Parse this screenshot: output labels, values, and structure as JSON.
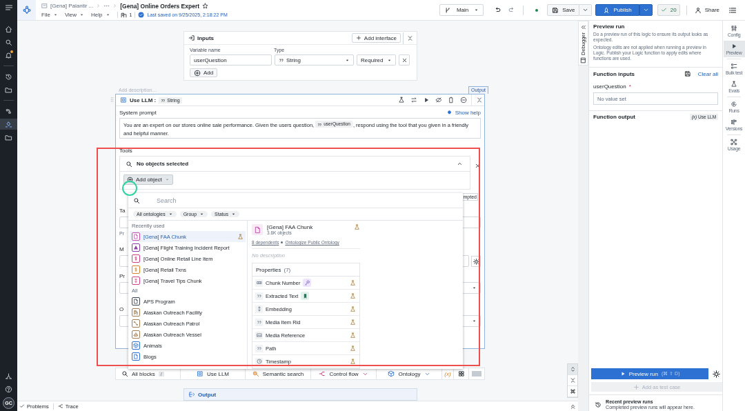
{
  "nav": {
    "items": [
      {
        "kind": "home",
        "selected": false
      },
      {
        "kind": "search",
        "selected": false
      },
      {
        "kind": "bell",
        "selected": false,
        "alert": true
      },
      {
        "kind": "history",
        "selected": false
      },
      {
        "kind": "folder",
        "selected": false
      },
      {
        "kind": "graph",
        "selected": false
      },
      {
        "kind": "logic",
        "selected": true
      },
      {
        "kind": "folder",
        "selected": false
      }
    ],
    "bottom": [
      {
        "kind": "network"
      },
      {
        "kind": "help"
      }
    ],
    "avatar": "GC"
  },
  "header": {
    "breadcrumb": "[Gena] Palantir ...",
    "title": "[Gena] Online Orders Expert",
    "menus": [
      "File",
      "View",
      "Help"
    ],
    "count": "1",
    "saved": "Last saved on 9/25/2025, 2:18:22 PM",
    "branch": "Main",
    "save": "Save",
    "publish": "Publish",
    "checks": "20",
    "share": "Share"
  },
  "inputs": {
    "title": "Inputs",
    "add_interface": "Add interface",
    "name_label": "Variable name",
    "type_label": "Type",
    "variable": "userQuestion",
    "type": "String",
    "required": "Required",
    "add": "Add"
  },
  "block": {
    "description_placeholder": "Add description…",
    "output_tag": "Output",
    "title": "Use LLM :",
    "type": "String",
    "prompt_label": "System prompt",
    "show_help": "Show help",
    "prompt_before": "You are an expert on our stores online sale performance. Given the users question,",
    "prompt_variable": "userQuestion",
    "prompt_after": ", respond using the tool that you given in a friendly and helpful manner.",
    "tools_label": "Tools",
    "tools_placeholder": "No objects selected",
    "add_object": "Add object",
    "chip": "mpted",
    "fragments": [
      "Ta",
      "Pr",
      "M",
      "Pr",
      "O"
    ]
  },
  "picker": {
    "search_placeholder": "Search",
    "filters": [
      "All ontologies",
      "Group",
      "Status"
    ],
    "sections": [
      {
        "title": "Recently used",
        "items": [
          {
            "label": "[Gena] FAA Chunk",
            "kind": "document",
            "color": "#c24fb0",
            "selected": true
          },
          {
            "label": "[Gena] Flight Training Incident Report",
            "kind": "warning",
            "color": "#8a3fa8",
            "selected": false
          },
          {
            "label": "[Gena] Online Retail Line Item",
            "kind": "dollar",
            "color": "#d43f8d",
            "selected": false
          },
          {
            "label": "[Gena] Retail Txns",
            "kind": "dollar",
            "color": "#d9822b",
            "selected": false
          },
          {
            "label": "[Gena] Travel Tips Chunk",
            "kind": "arrow",
            "color": "#d43f8d",
            "selected": false
          }
        ]
      },
      {
        "title": "All",
        "items": [
          {
            "label": "APS Program",
            "kind": "document",
            "color": "#3d4553",
            "selected": false
          },
          {
            "label": "Alaskan Outreach Facility",
            "kind": "building",
            "color": "#a67c52",
            "selected": false
          },
          {
            "label": "Alaskan Outreach Patrol",
            "kind": "route",
            "color": "#a67c52",
            "selected": false
          },
          {
            "label": "Alaskan Outreach Vessel",
            "kind": "boat",
            "color": "#a67c52",
            "selected": false
          },
          {
            "label": "Animals",
            "kind": "cube",
            "color": "#2d72d2",
            "selected": false
          },
          {
            "label": "Blogs",
            "kind": "document",
            "color": "#2d72d2",
            "selected": false
          }
        ]
      }
    ],
    "detail": {
      "title": "[Gena] FAA Chunk",
      "count": "3.6K objects",
      "dependents": "8 dependents",
      "ontology": "Ontologize Public Ontology",
      "description": "No description",
      "properties_title": "Properties",
      "properties_count": "(7)",
      "properties": [
        {
          "name": "Chunk Number",
          "kind": "number",
          "badge": {
            "kind": "key"
          }
        },
        {
          "name": "Extracted Text",
          "kind": "text",
          "badge": {
            "kind": "bookmark"
          }
        },
        {
          "name": "Embedding",
          "kind": "vector"
        },
        {
          "name": "Media Item Rid",
          "kind": "text"
        },
        {
          "name": "Media Reference",
          "kind": "media"
        },
        {
          "name": "Path",
          "kind": "text"
        },
        {
          "name": "Timestamp",
          "kind": "time"
        }
      ]
    }
  },
  "toolbar": [
    {
      "label": "All blocks",
      "kind": "search",
      "shortcut": "/"
    },
    {
      "label": "Use LLM",
      "kind": "llm"
    },
    {
      "label": "Semantic search",
      "kind": "semantic"
    },
    {
      "label": "Control flow",
      "kind": "flow",
      "menu": true
    },
    {
      "label": "Ontology",
      "kind": "cube",
      "menu": true
    },
    {
      "label": "(x)",
      "kind": "variable"
    }
  ],
  "output_card": "Output",
  "debugger": "Debugger",
  "panel": {
    "title": "Preview run",
    "description": "Do a preview run of this logic to ensure its output looks as expected.",
    "note": "Ontology edits are not applied when running a preview in Logic. Publish your Logic function to apply edits where functions are used.",
    "inputs_title": "Function inputs",
    "clear_all": "Clear all",
    "param": "userQuestion",
    "required": "*",
    "param_placeholder": "No value set",
    "output_title": "Function output",
    "output_chip_var": "(x)",
    "output_chip": "Use LLM",
    "run": "Preview run",
    "run_shortcut": "(⌘ ⇧ D)",
    "add_test": "Add as test case",
    "recent_title": "Recent preview runs",
    "recent_empty": "Completed preview runs will appear here."
  },
  "rail": [
    {
      "label": "Config",
      "kind": "sliders",
      "selected": false
    },
    {
      "label": "Preview",
      "kind": "play",
      "selected": true
    },
    {
      "label": "Bulk test",
      "kind": "bulk",
      "selected": false
    },
    {
      "label": "Evals",
      "kind": "flask",
      "selected": false
    },
    {
      "label": "Runs",
      "kind": "runs",
      "selected": false
    },
    {
      "label": "Versions",
      "kind": "versions",
      "selected": false
    },
    {
      "label": "Usage",
      "kind": "usage",
      "selected": false
    }
  ],
  "status": [
    "Problems",
    "Trace"
  ]
}
